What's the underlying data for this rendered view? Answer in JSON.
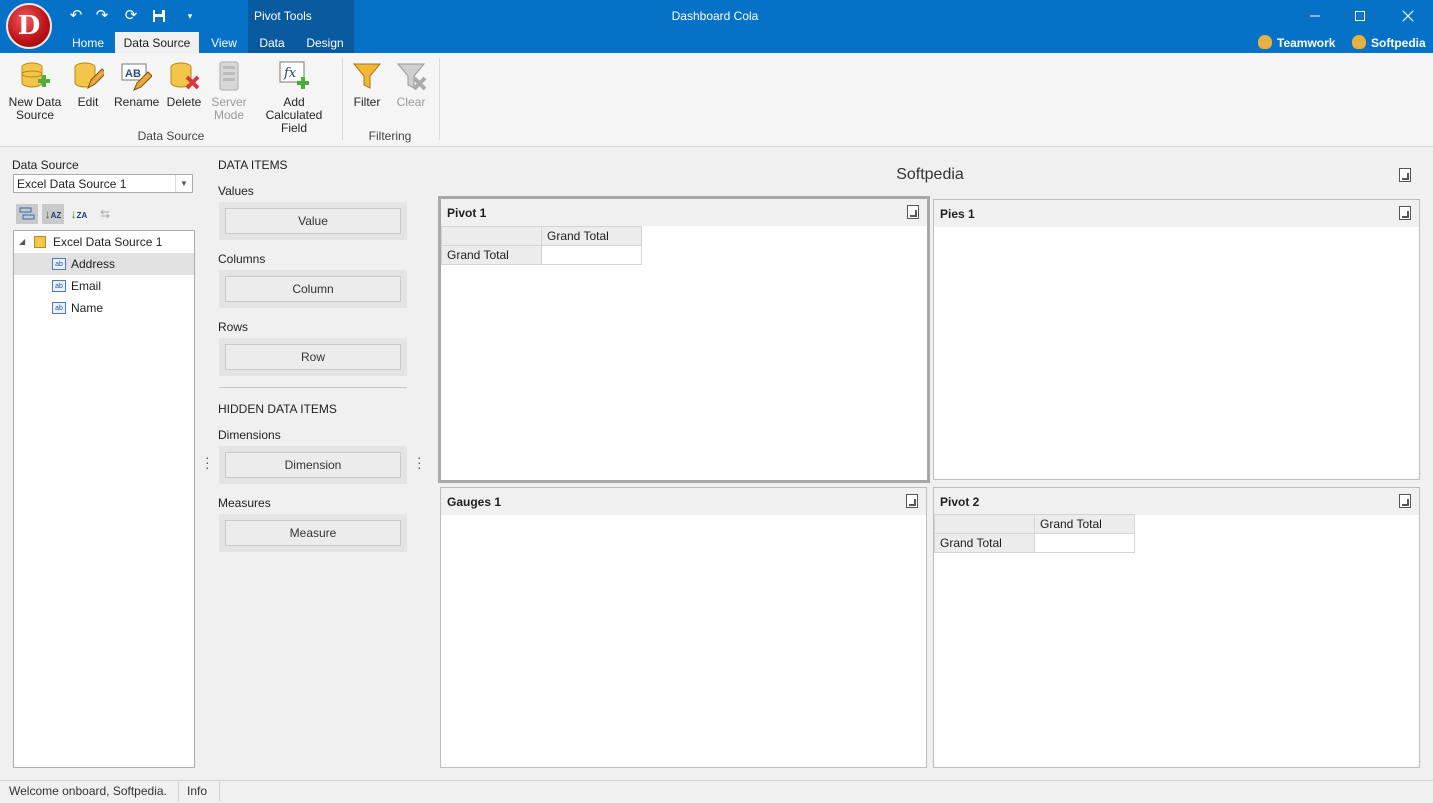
{
  "window": {
    "title": "Dashboard Cola",
    "app_letter": "D",
    "context_tab_group": "Pivot Tools",
    "header_links": [
      "Teamwork",
      "Softpedia"
    ]
  },
  "ribbon_tabs": [
    "Home",
    "Data Source",
    "View",
    "Data",
    "Design"
  ],
  "active_tab": "Data Source",
  "ribbon": {
    "buttons": [
      {
        "line1": "New Data",
        "line2": "Source",
        "icon": "database-add-icon"
      },
      {
        "line1": "Edit",
        "line2": "",
        "icon": "database-edit-icon"
      },
      {
        "line1": "Rename",
        "line2": "",
        "icon": "rename-icon"
      },
      {
        "line1": "Delete",
        "line2": "",
        "icon": "database-delete-icon"
      },
      {
        "line1": "Server",
        "line2": "Mode",
        "icon": "server-icon"
      },
      {
        "line1": "Add Calculated",
        "line2": "Field",
        "icon": "calculated-field-icon"
      },
      {
        "line1": "Filter",
        "line2": "",
        "icon": "funnel-icon"
      },
      {
        "line1": "Clear",
        "line2": "",
        "icon": "clear-filter-icon"
      }
    ],
    "groups": [
      "Data Source",
      "Filtering"
    ]
  },
  "data_source_pane": {
    "label": "Data Source",
    "combo_value": "Excel Data Source 1",
    "tree_root": "Excel Data Source 1",
    "fields": [
      "Address",
      "Email",
      "Name"
    ],
    "selected_field": "Address",
    "field_icon_text": "ab"
  },
  "data_items_pane": {
    "heading": "DATA ITEMS",
    "sections": [
      {
        "label": "Values",
        "button": "Value"
      },
      {
        "label": "Columns",
        "button": "Column"
      },
      {
        "label": "Rows",
        "button": "Row"
      }
    ],
    "hidden_heading": "HIDDEN DATA ITEMS",
    "hidden_sections": [
      {
        "label": "Dimensions",
        "button": "Dimension"
      },
      {
        "label": "Measures",
        "button": "Measure"
      }
    ]
  },
  "dashboard": {
    "title": "Softpedia",
    "items": [
      {
        "title": "Pivot 1",
        "type": "pivot",
        "col_header": "Grand Total",
        "row_header": "Grand Total",
        "selected": true
      },
      {
        "title": "Pies 1",
        "type": "pie"
      },
      {
        "title": "Gauges 1",
        "type": "gauge"
      },
      {
        "title": "Pivot 2",
        "type": "pivot",
        "col_header": "Grand Total",
        "row_header": "Grand Total"
      }
    ]
  },
  "status_bar": {
    "message": "Welcome onboard, Softpedia.",
    "info": "Info"
  },
  "colors": {
    "titlebar": "#0572c8",
    "context_group": "#0a5aa0",
    "selected_border": "#a8a8a8"
  }
}
